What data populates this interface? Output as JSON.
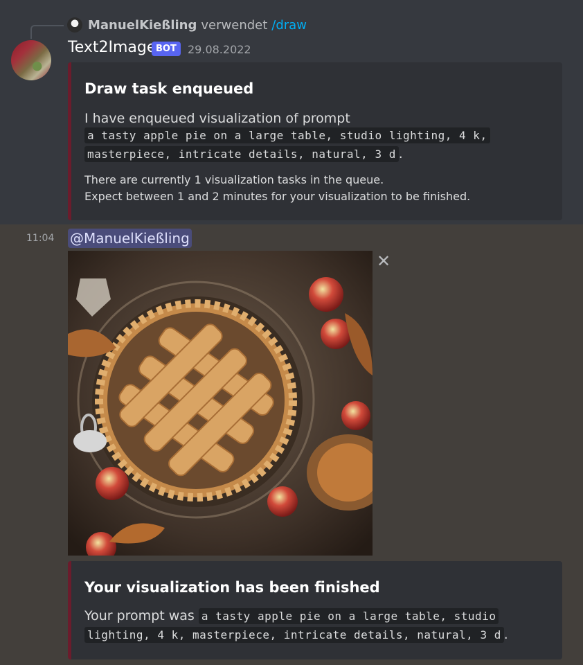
{
  "reply": {
    "username": "ManuelKießling",
    "verb": "verwendet",
    "command": "/draw"
  },
  "bot": {
    "username": "Text2Image",
    "badge": "BOT",
    "date": "29.08.2022"
  },
  "embed_enqueued": {
    "title": "Draw task enqueued",
    "description": "I have enqueued visualization of prompt",
    "prompt_line1": "a tasty apple pie on a large table, studio lighting, 4 k,",
    "prompt_line2": "masterpiece, intricate details, natural, 3 d",
    "prompt_suffix": ".",
    "queue_line": "There are currently 1 visualization tasks in the queue.",
    "eta_line": "Expect between 1 and 2 minutes for your visualization to be finished."
  },
  "result_message": {
    "time": "11:04",
    "mention": "@ManuelKießling"
  },
  "embed_finished": {
    "title": "Your visualization has been finished",
    "prefix": "Your prompt was",
    "prompt_line1": "a tasty apple pie on a large table, studio",
    "prompt_line2": "lighting, 4 k, masterpiece, intricate details, natural, 3 d",
    "prompt_suffix": "."
  },
  "icons": {
    "close": "close-icon"
  },
  "colors": {
    "embed_accent": "#6b1c2c",
    "bot_badge": "#5865f2",
    "slash_command": "#00aff4"
  }
}
